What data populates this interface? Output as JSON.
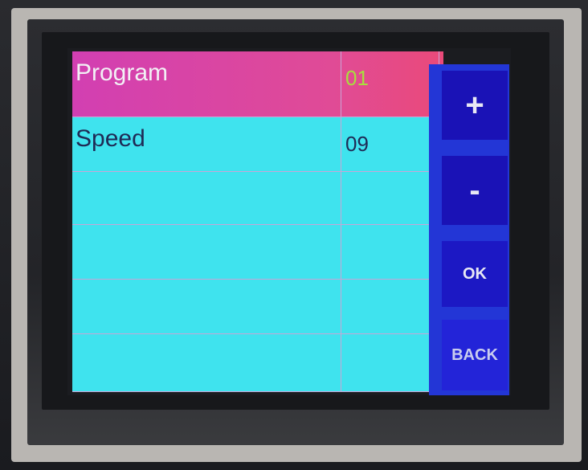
{
  "rows": [
    {
      "name": "Program",
      "value": "01",
      "selected": true
    },
    {
      "name": "Speed",
      "value": "09",
      "selected": false
    },
    {
      "name": "",
      "value": "",
      "selected": false
    },
    {
      "name": "",
      "value": "",
      "selected": false
    },
    {
      "name": "",
      "value": "",
      "selected": false
    },
    {
      "name": "",
      "value": "",
      "selected": false
    }
  ],
  "buttons": {
    "plus_label": "+",
    "minus_label": "-",
    "ok_label": "OK",
    "back_label": "BACK"
  },
  "colors": {
    "table_bg": "#3fe3ee",
    "selected_row": "#d23fb2",
    "selected_value": "#a7df3e",
    "button_column": "#2336d6",
    "button": "#1a12b6"
  }
}
